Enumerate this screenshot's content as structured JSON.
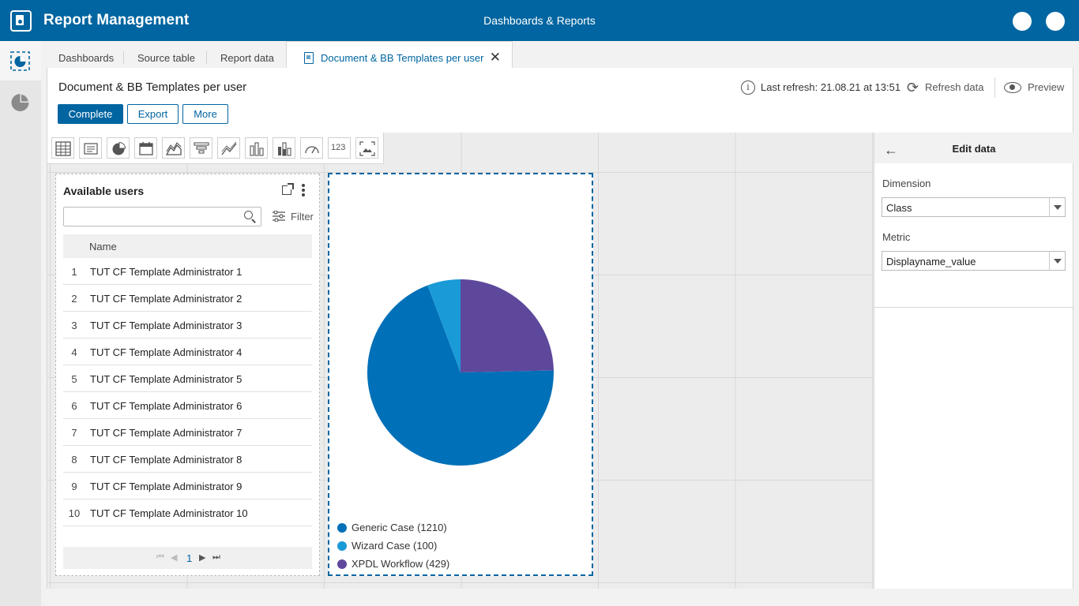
{
  "app": {
    "title": "Report Management",
    "center_title": "Dashboards & Reports"
  },
  "tabs": [
    {
      "label": "Dashboards"
    },
    {
      "label": "Source table"
    },
    {
      "label": "Report data"
    },
    {
      "label": "Document & BB Templates per user",
      "active": true
    }
  ],
  "header": {
    "title": "Document & BB Templates per user",
    "buttons": {
      "complete": "Complete",
      "export": "Export",
      "more": "More"
    },
    "last_refresh": "Last refresh: 21.08.21 at 13:51",
    "refresh_label": "Refresh data",
    "preview_label": "Preview"
  },
  "toolbar": {
    "tools": [
      "table-icon",
      "list-icon",
      "pie-chart-icon",
      "calendar-icon",
      "area-chart-icon",
      "funnel-icon",
      "line-chart-icon",
      "bar-chart-icon",
      "stacked-bar-icon",
      "gauge-icon",
      "number-icon",
      "image-icon"
    ],
    "number_label": "123"
  },
  "users_widget": {
    "title": "Available users",
    "search": {
      "value": "",
      "placeholder": ""
    },
    "filter_label": "Filter",
    "column_name": "Name",
    "rows": [
      {
        "num": "1",
        "name": "TUT CF Template Administrator 1"
      },
      {
        "num": "2",
        "name": "TUT CF Template Administrator 2"
      },
      {
        "num": "3",
        "name": "TUT CF Template Administrator 3"
      },
      {
        "num": "4",
        "name": "TUT CF Template Administrator 4"
      },
      {
        "num": "5",
        "name": "TUT CF Template Administrator 5"
      },
      {
        "num": "6",
        "name": "TUT CF Template Administrator 6"
      },
      {
        "num": "7",
        "name": "TUT CF Template Administrator 7"
      },
      {
        "num": "8",
        "name": "TUT CF Template Administrator 8"
      },
      {
        "num": "9",
        "name": "TUT CF Template Administrator 9"
      },
      {
        "num": "10",
        "name": "TUT CF Template Administrator 10"
      }
    ],
    "page": "1"
  },
  "chart_data": {
    "type": "pie",
    "title": "",
    "slices": [
      {
        "label": "Generic Case (1210)",
        "value": 1210,
        "color": "#0070b8"
      },
      {
        "label": "Wizard Case (100)",
        "value": 100,
        "color": "#1a9ad6"
      },
      {
        "label": "XPDL Workflow (429)",
        "value": 429,
        "color": "#5e489c"
      }
    ],
    "legend_position": "bottom-left"
  },
  "edit_panel": {
    "title": "Edit data",
    "dimension_label": "Dimension",
    "dimension_value": "Class",
    "metric_label": "Metric",
    "metric_value": "Displayname_value"
  },
  "colors": {
    "brand": "#0065a0",
    "accent": "#0070b8"
  }
}
